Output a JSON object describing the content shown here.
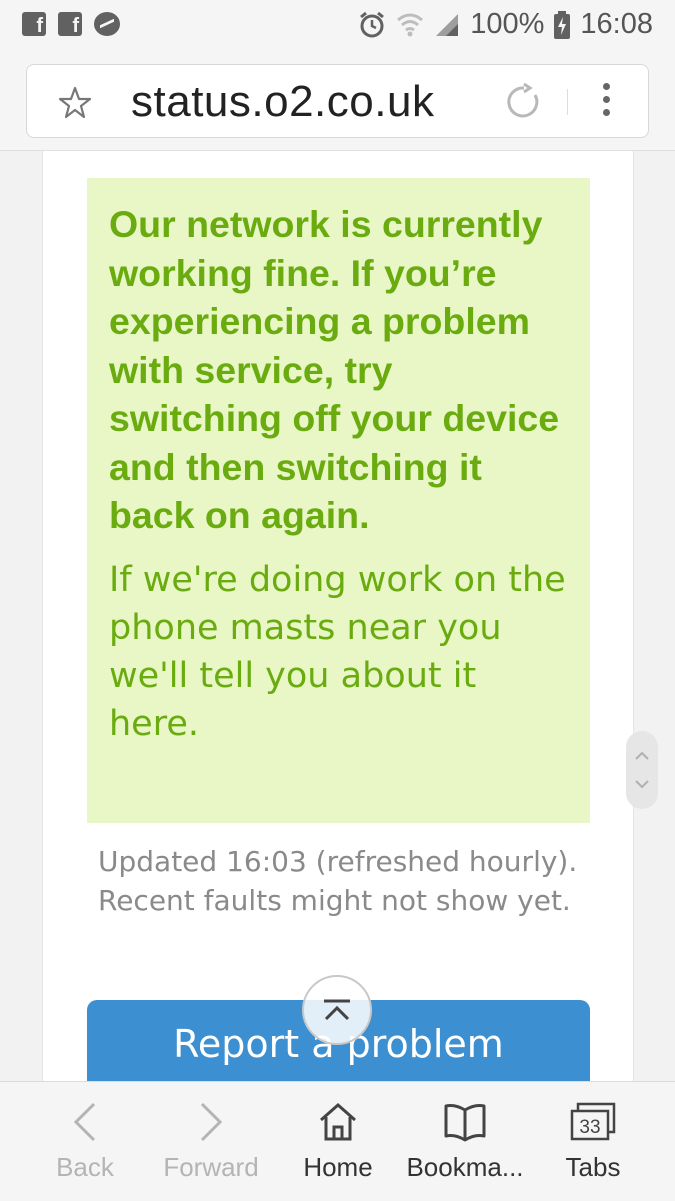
{
  "status_bar": {
    "battery": "100%",
    "time": "16:08",
    "left_icons": [
      "facebook-icon",
      "facebook-icon",
      "messenger-icon"
    ],
    "right_icons": [
      "alarm-icon",
      "wifi-icon",
      "signal-icon",
      "battery-charging-icon"
    ]
  },
  "browser": {
    "url": "status.o2.co.uk"
  },
  "page": {
    "status_heading": "Our network is currently working fine. If you’re experiencing a problem with service, try switching off your device and then switching it back on again.",
    "status_note": "If we're doing work on the phone masts near you we'll tell you about it here.",
    "updated_text": "Updated 16:03 (refreshed hourly). Recent faults might not show yet.",
    "report_button": "Report a problem"
  },
  "bottom_nav": {
    "back": "Back",
    "forward": "Forward",
    "home": "Home",
    "bookmarks": "Bookma...",
    "tabs": "Tabs",
    "tabs_count": "33"
  },
  "colors": {
    "status_box_bg": "#e9f7c7",
    "status_text": "#6aab0f",
    "button_blue": "#3c8fd0"
  }
}
